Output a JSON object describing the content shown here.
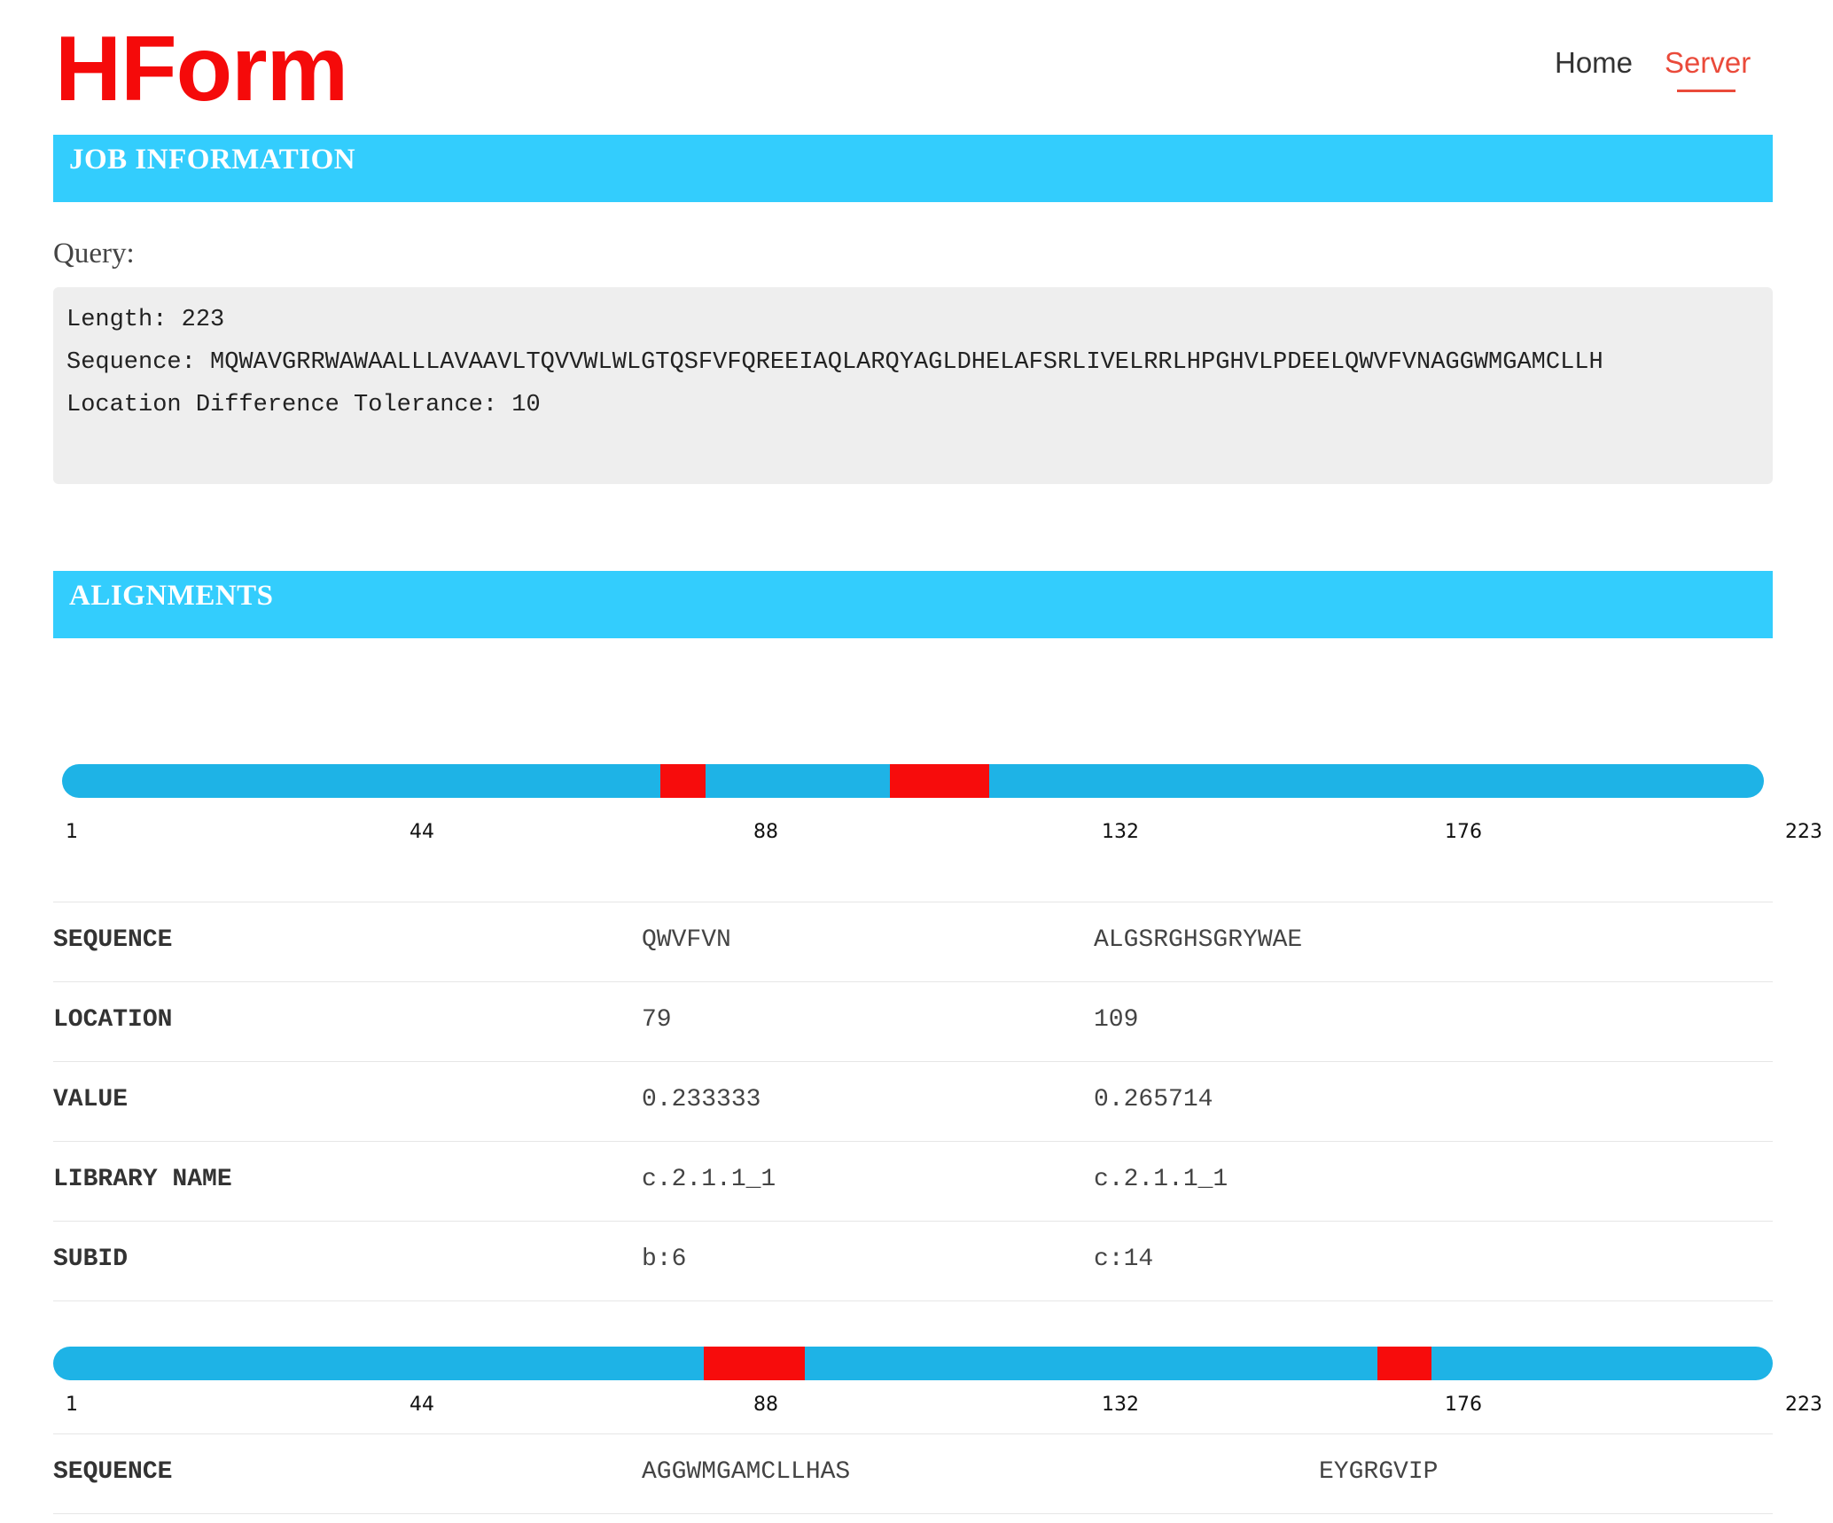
{
  "header": {
    "logo": "HForm",
    "nav": [
      {
        "label": "Home",
        "active": false
      },
      {
        "label": "Server",
        "active": true
      }
    ]
  },
  "colors": {
    "brand": "#f50a0a",
    "section_header": "#33cdfd",
    "track": "#1eb3e6",
    "highlight": "#f70c0c",
    "nav_active": "#ea4a3a"
  },
  "job_information": {
    "title": "JOB INFORMATION",
    "query_label": "Query:",
    "length_line": "Length: 223",
    "sequence_line": "Sequence: MQWAVGRRWAWAALLLAVAAVLTQVVWLWLGTQSFVFQREEIAQLARQYAGLDHELAFSRLIVELRRLHPGHVLPDEELQWVFVNAGGWMGAMCLLH",
    "tolerance_line": "Location Difference Tolerance: 10"
  },
  "alignments": {
    "title": "ALIGNMENTS",
    "sequence_length": 223,
    "ticks": [
      "1",
      "44",
      "88",
      "132",
      "176",
      "223"
    ],
    "row_labels": {
      "sequence": "SEQUENCE",
      "location": "LOCATION",
      "value": "VALUE",
      "library_name": "LIBRARY NAME",
      "subid": "SUBID"
    },
    "results": [
      {
        "segments": [
          {
            "start": 79,
            "end": 85
          },
          {
            "start": 109,
            "end": 122
          }
        ],
        "hits": [
          {
            "sequence": "QWVFVN",
            "location": "79",
            "value": "0.233333",
            "library_name": "c.2.1.1_1",
            "subid": "b:6"
          },
          {
            "sequence": "ALGSRGHSGRYWAE",
            "location": "109",
            "value": "0.265714",
            "library_name": "c.2.1.1_1",
            "subid": "c:14"
          }
        ]
      },
      {
        "segments": [
          {
            "start": 85,
            "end": 98
          },
          {
            "start": 172,
            "end": 179
          }
        ],
        "hits": [
          {
            "sequence": "AGGWMGAMCLLHAS"
          },
          {
            "sequence": "EYGRGVIP"
          }
        ]
      }
    ]
  }
}
